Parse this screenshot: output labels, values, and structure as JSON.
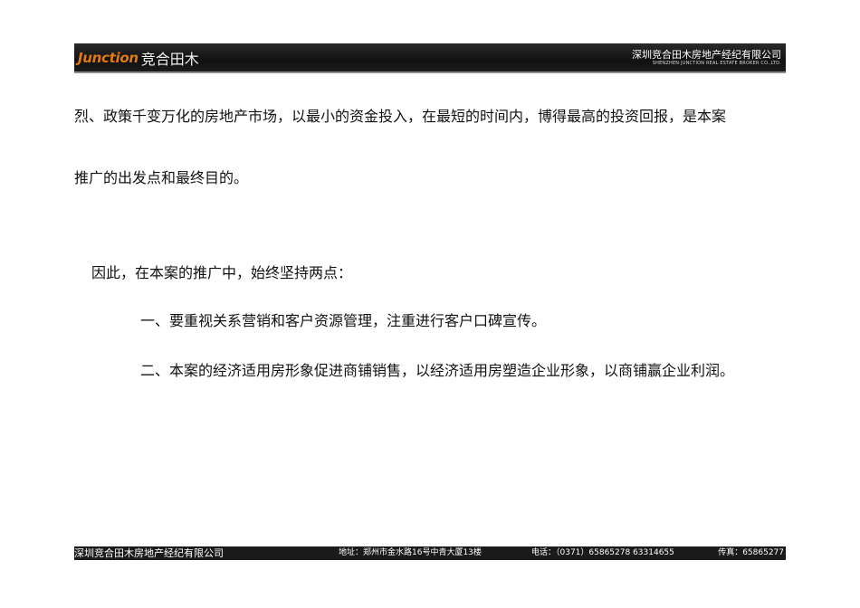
{
  "header": {
    "logo_en": "Junction",
    "logo_cn": "竞合田木",
    "company_cn": "深圳竞合田木房地产经纪有限公司",
    "company_en": "SHENZHEN JUNCTION REAL ESTATE BROKER CO.,LTD."
  },
  "body": {
    "line1": "烈、政策千变万化的房地产市场，以最小的资金投入，在最短的时间内，博得最高的投资回报，是本案",
    "line2": "推广的出发点和最终目的。",
    "line3": "因此，在本案的推广中，始终坚持两点：",
    "line4": "一、要重视关系营销和客户资源管理，注重进行客户口碑宣传。",
    "line5": "二、本案的经济适用房形象促进商铺销售，以经济适用房塑造企业形象，以商铺赢企业利润。"
  },
  "footer": {
    "company": "深圳竞合田木房地产经纪有限公司",
    "address": "地址：郑州市金水路16号中青大厦13楼",
    "phone": "电话：（0371）65865278  63314655",
    "fax": "传真：65865277"
  }
}
